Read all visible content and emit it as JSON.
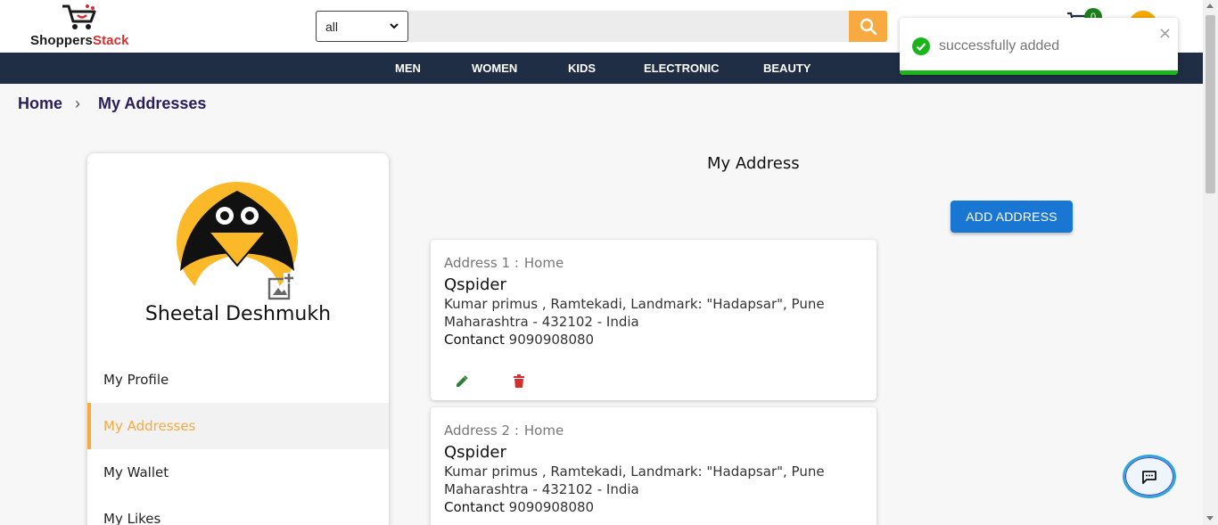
{
  "header": {
    "logo_text_main": "Shoppers",
    "logo_text_accent": "Stack",
    "category_select_value": "all",
    "search_placeholder": "",
    "cart_count": "0"
  },
  "nav": {
    "items": [
      "MEN",
      "WOMEN",
      "KIDS",
      "ELECTRONIC",
      "BEAUTY"
    ]
  },
  "toast": {
    "message": "successfully added",
    "close_glyph": "×"
  },
  "breadcrumb": {
    "home": "Home",
    "separator": "›",
    "current": "My Addresses"
  },
  "profile": {
    "name": "Sheetal Deshmukh",
    "menu": [
      "My Profile",
      "My Addresses",
      "My Wallet",
      "My Likes"
    ],
    "active_menu": "My Addresses"
  },
  "main": {
    "title": "My Address",
    "add_button": "ADD ADDRESS",
    "addresses": [
      {
        "label": "Address 1 :",
        "type": "Home",
        "name": "Qspider",
        "line1": "Kumar primus , Ramtekadi, Landmark: \"Hadapsar\", Pune",
        "line2": "Maharashtra - 432102 - India",
        "contact_label": "Contanct",
        "contact_value": "9090908080"
      },
      {
        "label": "Address 2 :",
        "type": "Home",
        "name": "Qspider",
        "line1": "Kumar primus , Ramtekadi, Landmark: \"Hadapsar\", Pune",
        "line2": "Maharashtra - 432102 - India",
        "contact_label": "Contanct",
        "contact_value": "9090908080"
      }
    ]
  },
  "colors": {
    "accent_orange": "#f8a940",
    "nav_bg": "#1f2e44",
    "primary_blue": "#1976d2",
    "success_green": "#1ab51a",
    "delete_red": "#d32f2f",
    "edit_green": "#2e7d32"
  },
  "icons": [
    "cart-logo-icon",
    "chevron-down-icon",
    "search-icon",
    "cart-icon",
    "check-circle-icon",
    "close-icon",
    "penguin-avatar",
    "add-photo-icon",
    "edit-icon",
    "delete-icon",
    "chat-icon"
  ]
}
